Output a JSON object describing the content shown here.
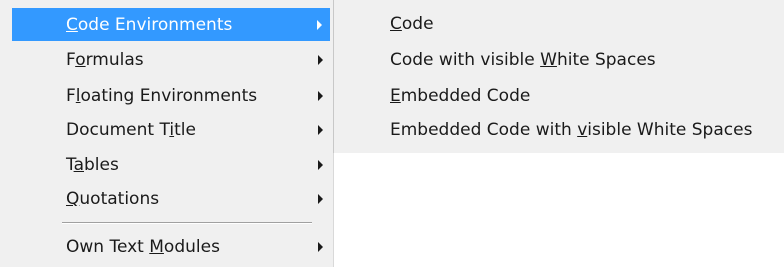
{
  "menu": {
    "items": [
      {
        "name": "menu-item-code-environments",
        "parts": [
          "",
          "C",
          "ode Environments"
        ],
        "selected": true,
        "submenu": true
      },
      {
        "name": "menu-item-formulas",
        "parts": [
          "F",
          "o",
          "rmulas"
        ],
        "submenu": true
      },
      {
        "name": "menu-item-floating-environments",
        "parts": [
          "F",
          "l",
          "oating Environments"
        ],
        "submenu": true
      },
      {
        "name": "menu-item-document-title",
        "parts": [
          "Document T",
          "i",
          "tle"
        ],
        "submenu": true
      },
      {
        "name": "menu-item-tables",
        "parts": [
          "T",
          "a",
          "bles"
        ],
        "submenu": true
      },
      {
        "name": "menu-item-quotations",
        "parts": [
          "",
          "Q",
          "uotations"
        ],
        "submenu": true
      },
      {
        "name": "menu-item-own-text-modules",
        "parts": [
          "Own Text ",
          "M",
          "odules"
        ],
        "submenu": true
      }
    ]
  },
  "submenu": {
    "items": [
      {
        "name": "submenu-item-code",
        "parts": [
          "",
          "C",
          "ode"
        ]
      },
      {
        "name": "submenu-item-code-visible-white-spaces",
        "parts": [
          "Code with visible ",
          "W",
          "hite Spaces"
        ]
      },
      {
        "name": "submenu-item-embedded-code",
        "parts": [
          "",
          "E",
          "mbedded Code"
        ]
      },
      {
        "name": "submenu-item-embedded-code-visible-white-spaces",
        "parts": [
          "Embedded Code with ",
          "v",
          "isible White Spaces"
        ]
      }
    ]
  },
  "colors": {
    "selection": "#3399ff",
    "menu_background": "#f0f0f0"
  }
}
